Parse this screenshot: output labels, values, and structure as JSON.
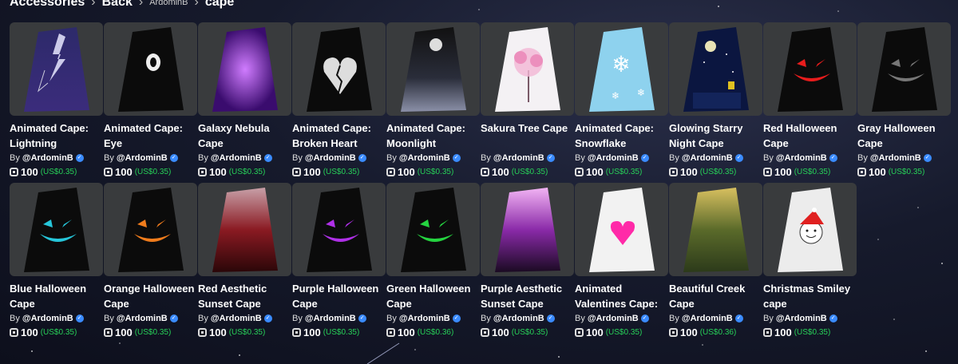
{
  "breadcrumb": {
    "items": [
      "Accessories",
      "Back",
      "ArdominB",
      "cape"
    ]
  },
  "cards": [
    {
      "name": "Animated Cape: Lightning",
      "creator": "@ArdominB",
      "robux": "100",
      "usd": "(US$0.35)",
      "art": "lightning"
    },
    {
      "name": "Animated Cape: Eye",
      "creator": "@ArdominB",
      "robux": "100",
      "usd": "(US$0.35)",
      "art": "eye"
    },
    {
      "name": "Galaxy Nebula Cape",
      "creator": "@ArdominB",
      "robux": "100",
      "usd": "(US$0.35)",
      "art": "nebula"
    },
    {
      "name": "Animated Cape: Broken Heart",
      "creator": "@ArdominB",
      "robux": "100",
      "usd": "(US$0.35)",
      "art": "heart"
    },
    {
      "name": "Animated Cape: Moonlight",
      "creator": "@ArdominB",
      "robux": "100",
      "usd": "(US$0.35)",
      "art": "moonlight"
    },
    {
      "name": "Sakura Tree Cape",
      "creator": "@ArdominB",
      "robux": "100",
      "usd": "(US$0.35)",
      "art": "sakura"
    },
    {
      "name": "Animated Cape: Snowflake",
      "creator": "@ArdominB",
      "robux": "100",
      "usd": "(US$0.35)",
      "art": "snow"
    },
    {
      "name": "Glowing Starry Night Cape",
      "creator": "@ArdominB",
      "robux": "100",
      "usd": "(US$0.35)",
      "art": "starry"
    },
    {
      "name": "Red Halloween Cape",
      "creator": "@ArdominB",
      "robux": "100",
      "usd": "(US$0.35)",
      "art": "red-face"
    },
    {
      "name": "Gray Halloween Cape",
      "creator": "@ArdominB",
      "robux": "100",
      "usd": "(US$0.35)",
      "art": "gray-face"
    },
    {
      "name": "Blue Halloween Cape",
      "creator": "@ArdominB",
      "robux": "100",
      "usd": "(US$0.35)",
      "art": "blue-face"
    },
    {
      "name": "Orange Halloween Cape",
      "creator": "@ArdominB",
      "robux": "100",
      "usd": "(US$0.35)",
      "art": "orange-face"
    },
    {
      "name": "Red Aesthetic Sunset Cape",
      "creator": "@ArdominB",
      "robux": "100",
      "usd": "(US$0.35)",
      "art": "red-sunset"
    },
    {
      "name": "Purple Halloween Cape",
      "creator": "@ArdominB",
      "robux": "100",
      "usd": "(US$0.35)",
      "art": "purple-face"
    },
    {
      "name": "Green Halloween Cape",
      "creator": "@ArdominB",
      "robux": "100",
      "usd": "(US$0.36)",
      "art": "green-face"
    },
    {
      "name": "Purple Aesthetic Sunset Cape",
      "creator": "@ArdominB",
      "robux": "100",
      "usd": "(US$0.35)",
      "art": "purple-sunset"
    },
    {
      "name": "Animated Valentines Cape:",
      "creator": "@ArdominB",
      "robux": "100",
      "usd": "(US$0.35)",
      "art": "valentine"
    },
    {
      "name": "Beautiful Creek Cape",
      "creator": "@ArdominB",
      "robux": "100",
      "usd": "(US$0.36)",
      "art": "creek"
    },
    {
      "name": "Christmas Smiley cape",
      "creator": "@ArdominB",
      "robux": "100",
      "usd": "(US$0.35)",
      "art": "christmas"
    }
  ],
  "labels": {
    "by": "By"
  },
  "colors": {
    "price_usd": "#27d058",
    "card_bg": "#393b3d",
    "verified": "#3a8bff"
  }
}
